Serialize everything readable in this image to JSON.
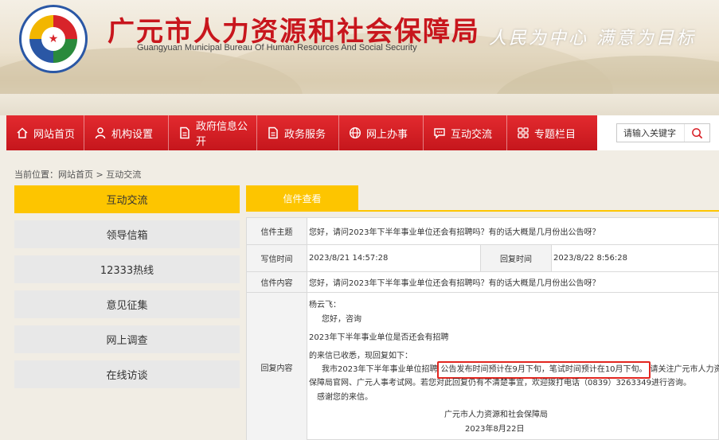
{
  "header": {
    "title": "广元市人力资源和社会保障局",
    "subtitle": "Guangyuan Municipal Bureau Of Human Resources And Social Security",
    "slogan": "人民为中心  满意为目标"
  },
  "nav": {
    "items": [
      {
        "label": "网站首页",
        "icon": "home-icon"
      },
      {
        "label": "机构设置",
        "icon": "user-icon"
      },
      {
        "label": "政府信息公开",
        "icon": "document-icon"
      },
      {
        "label": "政务服务",
        "icon": "document-icon"
      },
      {
        "label": "网上办事",
        "icon": "globe-icon"
      },
      {
        "label": "互动交流",
        "icon": "chat-icon"
      },
      {
        "label": "专题栏目",
        "icon": "grid-icon"
      }
    ],
    "search_placeholder": "请输入关键字"
  },
  "breadcrumb": "当前位置：网站首页 > 互动交流",
  "sidebar": {
    "items": [
      {
        "label": "互动交流",
        "active": true
      },
      {
        "label": "领导信箱",
        "active": false
      },
      {
        "label": "12333热线",
        "active": false
      },
      {
        "label": "意见征集",
        "active": false
      },
      {
        "label": "网上调查",
        "active": false
      },
      {
        "label": "在线访谈",
        "active": false
      }
    ]
  },
  "main": {
    "tab_label": "信件查看",
    "letter": {
      "subject_label": "信件主题",
      "subject": "您好，请问2023年下半年事业单位还会有招聘吗？有的话大概是几月份出公告呀？",
      "write_time_label": "写信时间",
      "write_time": "2023/8/21 14:57:28",
      "reply_time_label": "回复时间",
      "reply_time": "2023/8/22 8:56:28",
      "content_label": "信件内容",
      "content": "您好，请问2023年下半年事业单位还会有招聘吗？有的话大概是几月份出公告呀？",
      "reply_label": "回复内容",
      "reply": {
        "greeting": "杨云飞：",
        "hello": "您好，咨询",
        "topic": "2023年下半年事业单位是否还会有招聘",
        "received": "的来信已收悉，现回复如下：",
        "line1_prefix": "我市2023年下半年事业单位招聘",
        "line1_highlight": "公告发布时间预计在9月下旬，笔试时间预计在10月下旬。",
        "line1_suffix": "请关注广元市人力资源和社会",
        "line2": "保障局官网、广元人事考试网。若您对此回复仍有不清楚事宜，欢迎拨打电话（0839）3263349进行咨询。",
        "thanks": "感谢您的来信。",
        "signature": "广元市人力资源和社会保障局",
        "date": "2023年8月22日"
      }
    }
  },
  "colors": {
    "brand_red": "#c8161d",
    "nav_red": "#d81e25",
    "accent_yellow": "#fdc500",
    "highlight_red": "#e2261f"
  }
}
